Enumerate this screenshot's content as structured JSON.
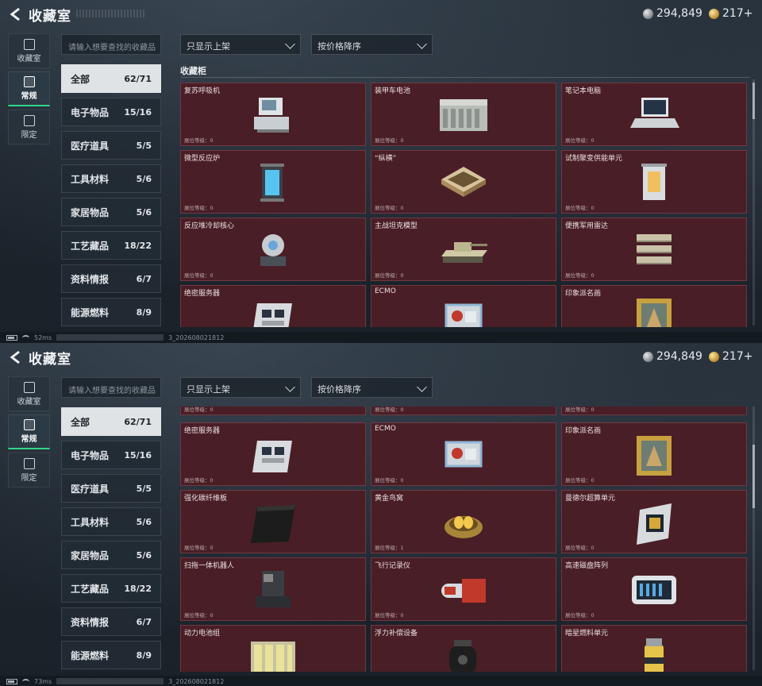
{
  "header": {
    "title": "收藏室",
    "silver_amount": "294,849",
    "gold_amount": "217+"
  },
  "side_tabs": [
    {
      "label": "收藏室",
      "icon": "archive-icon",
      "active": false
    },
    {
      "label": "常规",
      "icon": "picture-icon",
      "active": true
    },
    {
      "label": "限定",
      "icon": "limited-picture-icon",
      "active": false
    }
  ],
  "search": {
    "placeholder": "请输入想要查找的收藏品"
  },
  "filters": {
    "shelf_filter": "只显示上架",
    "sort_order": "按价格降序"
  },
  "categories": [
    {
      "name": "全部",
      "count": "62/71",
      "active": true
    },
    {
      "name": "电子物品",
      "count": "15/16"
    },
    {
      "name": "医疗道具",
      "count": "5/5"
    },
    {
      "name": "工具材料",
      "count": "5/6"
    },
    {
      "name": "家居物品",
      "count": "5/6"
    },
    {
      "name": "工艺藏品",
      "count": "18/22"
    },
    {
      "name": "资料情报",
      "count": "6/7"
    },
    {
      "name": "能源燃料",
      "count": "8/9"
    }
  ],
  "section_title": "收藏柜",
  "level_prefix": "展位等级：",
  "panel1_items": [
    {
      "name": "复苏呼吸机",
      "level": "展位等级：0",
      "icon": "ventilator-icon"
    },
    {
      "name": "装甲车电池",
      "level": "展位等级：0",
      "icon": "battery-icon"
    },
    {
      "name": "笔记本电脑",
      "level": "展位等级：0",
      "icon": "laptop-icon"
    },
    {
      "name": "微型反应炉",
      "level": "展位等级：0",
      "icon": "reactor-icon"
    },
    {
      "name": "“纵横”",
      "level": "展位等级：0",
      "icon": "chessboard-icon"
    },
    {
      "name": "试制聚变供能单元",
      "level": "展位等级：0",
      "icon": "fusion-cell-icon"
    },
    {
      "name": "反应堆冷却核心",
      "level": "展位等级：0",
      "icon": "cooling-core-icon"
    },
    {
      "name": "主战坦克模型",
      "level": "展位等级：0",
      "icon": "tank-icon"
    },
    {
      "name": "便携军用雷达",
      "level": "展位等级：0",
      "icon": "radar-icon"
    },
    {
      "name": "绝密服务器",
      "level": "",
      "icon": "server-icon"
    },
    {
      "name": "ECMO",
      "level": "",
      "icon": "ecmo-icon"
    },
    {
      "name": "印象派名画",
      "level": "",
      "icon": "painting-icon"
    }
  ],
  "panel2_top_levels": [
    "展位等级：0",
    "展位等级：0",
    "展位等级：0"
  ],
  "panel2_items": [
    {
      "name": "绝密服务器",
      "level": "展位等级：0",
      "icon": "server-icon"
    },
    {
      "name": "ECMO",
      "level": "展位等级：0",
      "icon": "ecmo-icon"
    },
    {
      "name": "印象派名画",
      "level": "展位等级：0",
      "icon": "painting-icon"
    },
    {
      "name": "强化碳纤维板",
      "level": "展位等级：0",
      "icon": "carbon-plate-icon"
    },
    {
      "name": "黄金鸟窝",
      "level": "展位等级：1",
      "icon": "golden-nest-icon"
    },
    {
      "name": "曼德尔超算单元",
      "level": "展位等级：0",
      "icon": "supercomputer-icon"
    },
    {
      "name": "扫拖一体机器人",
      "level": "展位等级：0",
      "icon": "robot-vacuum-icon"
    },
    {
      "name": "飞行记录仪",
      "level": "展位等级：0",
      "icon": "flight-recorder-icon"
    },
    {
      "name": "高速磁盘阵列",
      "level": "展位等级：0",
      "icon": "disk-array-icon"
    },
    {
      "name": "动力电池组",
      "level": "",
      "icon": "power-battery-icon"
    },
    {
      "name": "浮力补偿设备",
      "level": "",
      "icon": "buoyancy-device-icon"
    },
    {
      "name": "暗星燃料单元",
      "level": "",
      "icon": "fuel-cell-icon"
    }
  ],
  "status_bar": [
    {
      "ping": "52ms",
      "build": "3_202608021812"
    },
    {
      "ping": "73ms",
      "build": "3_202608021812"
    }
  ],
  "colors": {
    "card_bg": "#4a1e26",
    "active_tab_accent": "#34d58a",
    "active_category_bg": "#dfe3e6"
  }
}
